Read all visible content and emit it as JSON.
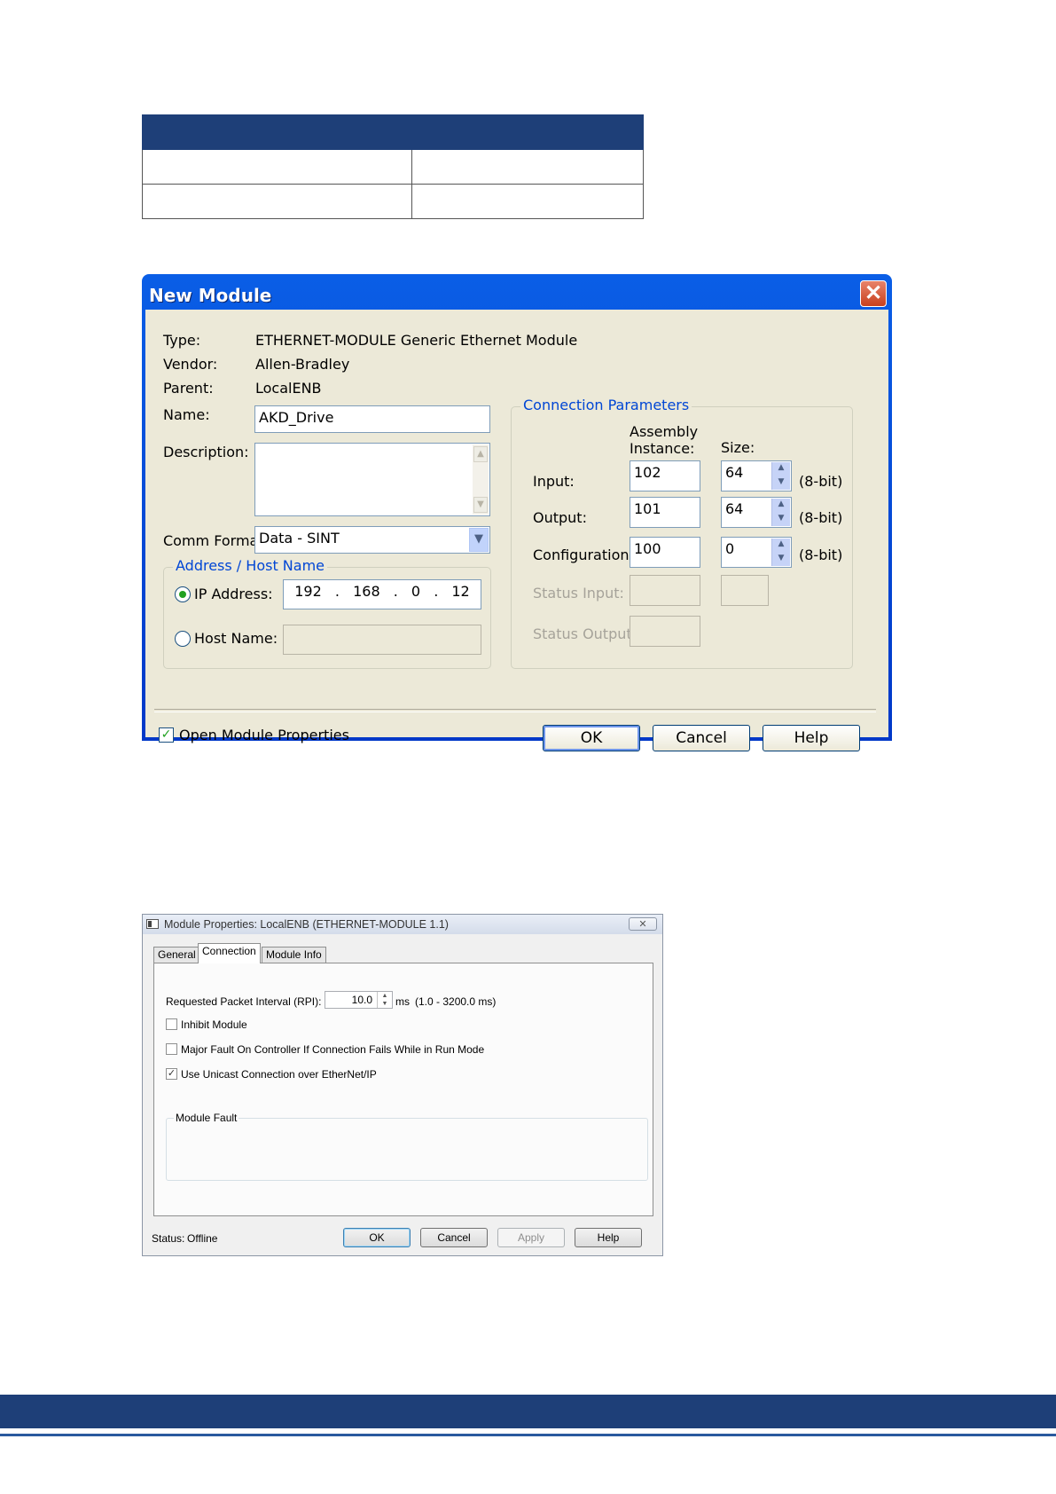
{
  "doc_table": {
    "headers": [
      "",
      ""
    ],
    "rows": [
      [
        "",
        ""
      ],
      [
        "",
        ""
      ]
    ]
  },
  "new_module": {
    "title": "New Module",
    "close_glyph": "✕",
    "type_label": "Type:",
    "type_value": "ETHERNET-MODULE Generic Ethernet Module",
    "vendor_label": "Vendor:",
    "vendor_value": "Allen-Bradley",
    "parent_label": "Parent:",
    "parent_value": "LocalENB",
    "name_label": "Name:",
    "name_value": "AKD_Drive",
    "description_label": "Description:",
    "description_value": "",
    "comm_format_label": "Comm Format:",
    "comm_format_value": "Data - SINT",
    "address_group_label": "Address / Host Name",
    "ip_address_label": "IP Address:",
    "ip_octets": [
      "192",
      "168",
      "0",
      "12"
    ],
    "ip_dot": ".",
    "host_name_label": "Host Name:",
    "host_name_value": "",
    "address_mode": "ip",
    "connection_group_label": "Connection Parameters",
    "assembly_instance_header_line1": "Assembly",
    "assembly_instance_header_line2": "Instance:",
    "size_header": "Size:",
    "rows": {
      "input": {
        "label": "Input:",
        "instance": "102",
        "size": "64",
        "unit": "(8-bit)"
      },
      "output": {
        "label": "Output:",
        "instance": "101",
        "size": "64",
        "unit": "(8-bit)"
      },
      "configuration": {
        "label": "Configuration:",
        "instance": "100",
        "size": "0",
        "unit": "(8-bit)"
      },
      "status_input": {
        "label": "Status Input:",
        "instance": "",
        "size": ""
      },
      "status_output": {
        "label": "Status Output:",
        "instance": ""
      }
    },
    "open_props_label": "Open Module Properties",
    "open_props_checked": true,
    "ok_label": "OK",
    "cancel_label": "Cancel",
    "help_label": "Help",
    "title_bar_color": "#0a5ee6",
    "group_label_color": "#0046d5"
  },
  "module_properties": {
    "title": "Module Properties: LocalENB (ETHERNET-MODULE 1.1)",
    "close_glyph": "✕",
    "tabs": [
      "General",
      "Connection",
      "Module Info"
    ],
    "active_tab": "Connection",
    "rpi_label": "Requested Packet Interval (RPI):",
    "rpi_value": "10.0",
    "rpi_unit": "ms",
    "rpi_range": "(1.0 - 3200.0 ms)",
    "inhibit_label": "Inhibit Module",
    "inhibit_checked": false,
    "major_fault_label": "Major Fault On Controller If Connection Fails While in Run Mode",
    "major_fault_checked": false,
    "unicast_label": "Use Unicast Connection over EtherNet/IP",
    "unicast_checked": true,
    "check_glyph": "✓",
    "module_fault_label": "Module Fault",
    "status_label": "Status:",
    "status_value": "Offline",
    "ok_label": "OK",
    "cancel_label": "Cancel",
    "apply_label": "Apply",
    "help_label": "Help"
  },
  "footer": {
    "bar_color": "#1e3f78"
  }
}
